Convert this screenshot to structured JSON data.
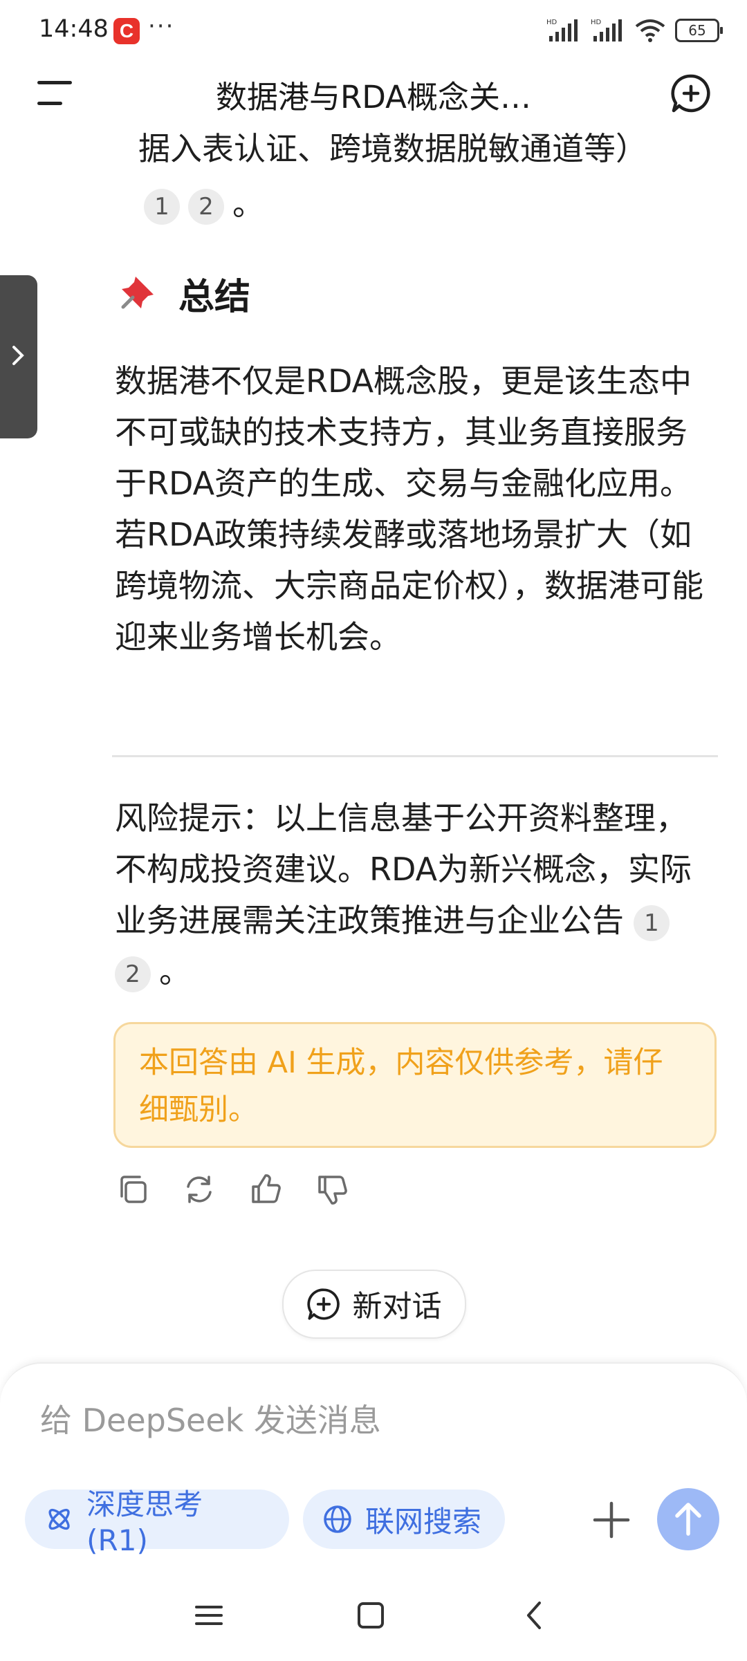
{
  "status_bar": {
    "time": "14:48",
    "app_badge": "C",
    "dots": "···",
    "battery": "65",
    "network_label_1": "HD",
    "network_label_2": "HD"
  },
  "header": {
    "title": "数据港与RDA概念关…",
    "menu_icon": "menu-icon",
    "new_chat_icon": "new-chat-plus-icon"
  },
  "content": {
    "top_para_line": "据入表认证、跨境数据脱敏通道等）",
    "top_citations": [
      "1",
      "2"
    ],
    "top_tail": "。",
    "summary_heading": "总结",
    "summary_icon": "pushpin-icon",
    "summary_text": "数据港不仅是RDA概念股，更是该生态中不可或缺的技术支持方，其业务直接服务于RDA资产的生成、交易与金融化应用。若RDA政策持续发酵或落地场景扩大（如跨境物流、大宗商品定价权），数据港可能迎来业务增长机会。",
    "risk_text": "风险提示：以上信息基于公开资料整理，不构成投资建议。RDA为新兴概念，实际业务进展需关注政策推进与企业公告",
    "risk_citations": [
      "1",
      "2"
    ],
    "risk_tail": "。",
    "ai_notice": "本回答由 AI 生成，内容仅供参考，请仔细甄别。"
  },
  "actions": [
    "copy-icon",
    "regenerate-icon",
    "thumbs-up-icon",
    "thumbs-down-icon"
  ],
  "new_chat_button": "新对话",
  "composer": {
    "placeholder": "给 DeepSeek 发送消息",
    "deep_think_label": "深度思考 (R1)",
    "web_search_label": "联网搜索"
  },
  "colors": {
    "accent": "#3f6fe0",
    "chip_bg": "#e8f0fd",
    "notice_text": "#f0a11b",
    "notice_bg": "#fff5de",
    "send_bg": "#9db9f6"
  }
}
